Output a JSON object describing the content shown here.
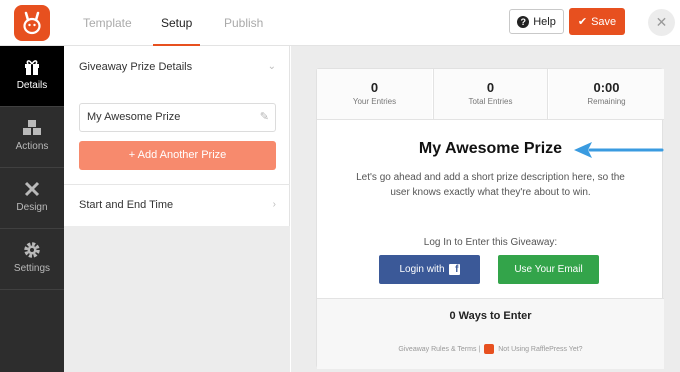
{
  "topbar": {
    "tabs": [
      {
        "label": "Template",
        "active": false
      },
      {
        "label": "Setup",
        "active": true
      },
      {
        "label": "Publish",
        "active": false
      }
    ],
    "help_label": "Help",
    "save_label": "Save",
    "close_glyph": "✕",
    "brand_color": "#e7501f"
  },
  "sidebar": {
    "items": [
      {
        "label": "Details",
        "icon": "gift-icon",
        "active": true
      },
      {
        "label": "Actions",
        "icon": "cubes-icon",
        "active": false
      },
      {
        "label": "Design",
        "icon": "paint-tools-icon",
        "active": false
      },
      {
        "label": "Settings",
        "icon": "gear-icon",
        "active": false
      }
    ]
  },
  "panel": {
    "prize_section_title": "Giveaway Prize Details",
    "prize_name": "My Awesome Prize",
    "add_prize_label": "Add Another Prize",
    "time_section_title": "Start and End Time"
  },
  "preview": {
    "stats": [
      {
        "value": "0",
        "caption": "Your Entries"
      },
      {
        "value": "0",
        "caption": "Total Entries"
      },
      {
        "value": "0:00",
        "caption": "Remaining"
      }
    ],
    "title": "My Awesome Prize",
    "description": "Let's go ahead and add a short prize description here, so the user knows exactly what they're about to win.",
    "login_label": "Log In to Enter this Giveaway:",
    "login_facebook_label": "Login with",
    "login_email_label": "Use Your Email",
    "ways_label": "0 Ways to Enter",
    "footer_rules": "Giveaway Rules & Terms |",
    "footer_promo": "Not Using RafflePress Yet?"
  }
}
